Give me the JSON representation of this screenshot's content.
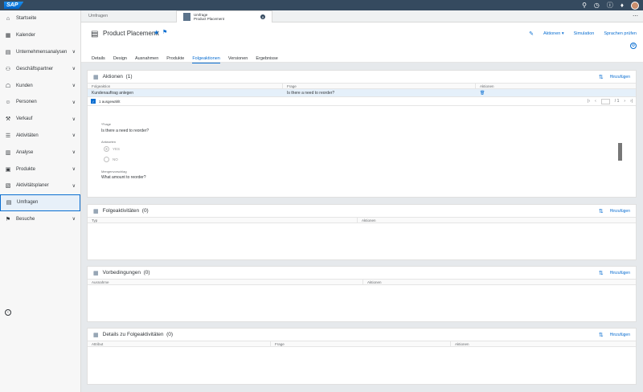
{
  "shell": {
    "logo": "SAP",
    "icons": [
      "search-icon",
      "history-icon",
      "help-icon",
      "bell-icon"
    ]
  },
  "sidebar": {
    "items": [
      {
        "label": "Startseite",
        "icon": "home-icon",
        "chevron": false
      },
      {
        "label": "Kalender",
        "icon": "calendar-icon",
        "chevron": false
      },
      {
        "label": "Unternehmensanalysen",
        "icon": "analytics-icon",
        "chevron": true
      },
      {
        "label": "Geschäftspartner",
        "icon": "partner-icon",
        "chevron": true
      },
      {
        "label": "Kunden",
        "icon": "customer-icon",
        "chevron": true
      },
      {
        "label": "Personen",
        "icon": "person-icon",
        "chevron": true
      },
      {
        "label": "Verkauf",
        "icon": "sales-icon",
        "chevron": true
      },
      {
        "label": "Aktivitäten",
        "icon": "activity-icon",
        "chevron": true
      },
      {
        "label": "Analyse",
        "icon": "analysis-icon",
        "chevron": true
      },
      {
        "label": "Produkte",
        "icon": "product-icon",
        "chevron": true
      },
      {
        "label": "Aktivitätsplaner",
        "icon": "planner-icon",
        "chevron": true
      },
      {
        "label": "Umfragen",
        "icon": "survey-icon",
        "chevron": false,
        "active": true
      },
      {
        "label": "Besuche",
        "icon": "visit-icon",
        "chevron": true
      }
    ]
  },
  "tabs": {
    "first": "Umfragen",
    "active_line1": "Umfrage",
    "active_line2": "Product Placement"
  },
  "header": {
    "title": "Product Placememt",
    "actions_label": "Aktionen",
    "simulation_label": "Simulation",
    "languages_label": "Sprachen prüfen"
  },
  "subtabs": [
    "Details",
    "Design",
    "Ausnahmen",
    "Produkte",
    "Folgeaktionen",
    "Versionen",
    "Ergebnisse"
  ],
  "active_subtab": "Folgeaktionen",
  "panel_actions": {
    "title": "Aktionen",
    "count": "(1)",
    "add_label": "Hinzufügen",
    "columns": [
      "Folgeaktion",
      "Frage",
      "Aktionen"
    ],
    "row": {
      "folgeaktion": "Kundenauftrag anlegen",
      "frage": "Is there a need to reorder?"
    },
    "selected": "1 ausgewählt",
    "pager": "/ 1",
    "detail": {
      "q_label": "*Frage",
      "q_value": "Is there a need to reorder?",
      "answers_label": "Antworten",
      "answer_yes": "YES",
      "answer_no": "NO",
      "qty_label": "Mengenvorschlag",
      "qty_value": "What amount to reorder?"
    }
  },
  "panel_follow": {
    "title": "Folgeaktivitäten",
    "count": "(0)",
    "add_label": "Hinzufügen",
    "columns": [
      "Typ",
      "Aktionen"
    ]
  },
  "panel_pre": {
    "title": "Vorbedingungen",
    "count": "(0)",
    "add_label": "Hinzufügen",
    "columns": [
      "Ausnahme",
      "Aktionen"
    ]
  },
  "panel_details": {
    "title": "Details zu Folgeaktivitäten",
    "count": "(0)",
    "add_label": "Hinzufügen",
    "columns": [
      "Attribut",
      "Frage",
      "Aktionen"
    ]
  }
}
